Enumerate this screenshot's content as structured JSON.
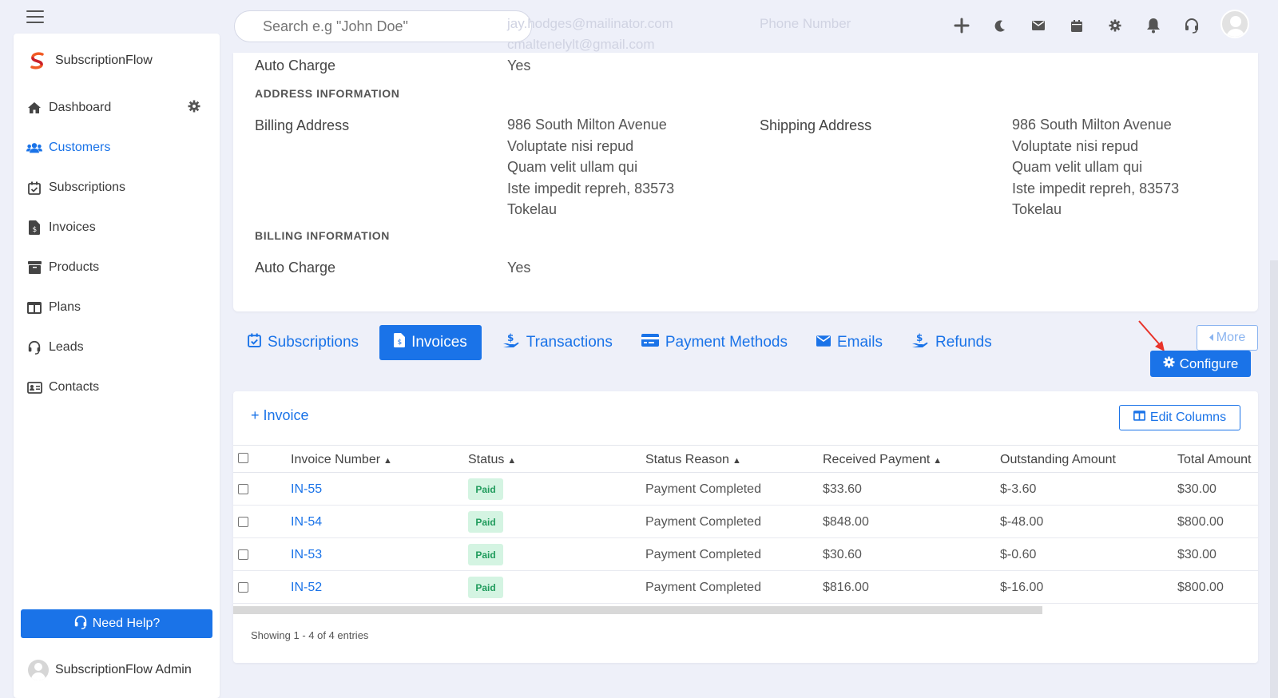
{
  "header": {
    "search_placeholder": "Search e.g \"John Doe\"",
    "ghost_email": "jay.hodges@mailinator.com",
    "ghost_phone": "Phone Number",
    "ghost_email2": "cmaltenelylt@gmail.com"
  },
  "sidebar": {
    "brand": "SubscriptionFlow",
    "items": [
      {
        "label": "Dashboard",
        "icon": "home-icon"
      },
      {
        "label": "Customers",
        "icon": "users-icon"
      },
      {
        "label": "Subscriptions",
        "icon": "calendar-check-icon"
      },
      {
        "label": "Invoices",
        "icon": "invoice-icon"
      },
      {
        "label": "Products",
        "icon": "archive-icon"
      },
      {
        "label": "Plans",
        "icon": "columns-icon"
      },
      {
        "label": "Leads",
        "icon": "headset-icon"
      },
      {
        "label": "Contacts",
        "icon": "id-card-icon"
      }
    ],
    "active": "Customers",
    "help_label": "Need Help?",
    "admin_name": "SubscriptionFlow Admin"
  },
  "info": {
    "auto_charge_label": "Auto Charge",
    "auto_charge_value": "Yes",
    "address_section": "ADDRESS INFORMATION",
    "billing_address_label": "Billing Address",
    "billing_address_lines": [
      "986 South Milton Avenue",
      "Voluptate nisi repud",
      "Quam velit ullam qui",
      "Iste impedit repreh, 83573",
      "Tokelau"
    ],
    "shipping_address_label": "Shipping Address",
    "shipping_address_lines": [
      "986 South Milton Avenue",
      "Voluptate nisi repud",
      "Quam velit ullam qui",
      "Iste impedit repreh, 83573",
      "Tokelau"
    ],
    "billing_section": "BILLING INFORMATION",
    "billing_auto_charge_label": "Auto Charge",
    "billing_auto_charge_value": "Yes"
  },
  "tabs": {
    "items": [
      "Subscriptions",
      "Invoices",
      "Transactions",
      "Payment Methods",
      "Emails",
      "Refunds"
    ],
    "active": "Invoices",
    "more_label": "More",
    "configure_label": "Configure"
  },
  "table": {
    "add_label": "+ Invoice",
    "edit_columns_label": "Edit Columns",
    "columns": [
      "Invoice Number",
      "Status",
      "Status Reason",
      "Received Payment",
      "Outstanding Amount",
      "Total Amount"
    ],
    "rows": [
      {
        "number": "IN-55",
        "status": "Paid",
        "reason": "Payment Completed",
        "received": "$33.60",
        "outstanding": "$-3.60",
        "total": "$30.00"
      },
      {
        "number": "IN-54",
        "status": "Paid",
        "reason": "Payment Completed",
        "received": "$848.00",
        "outstanding": "$-48.00",
        "total": "$800.00"
      },
      {
        "number": "IN-53",
        "status": "Paid",
        "reason": "Payment Completed",
        "received": "$30.60",
        "outstanding": "$-0.60",
        "total": "$30.00"
      },
      {
        "number": "IN-52",
        "status": "Paid",
        "reason": "Payment Completed",
        "received": "$816.00",
        "outstanding": "$-16.00",
        "total": "$800.00"
      }
    ],
    "showing": "Showing 1 - 4 of 4 entries"
  },
  "colors": {
    "accent": "#1a73e8",
    "paid_bg": "#d4f4e2",
    "paid_text": "#1f9b5c",
    "page_bg": "#eef0f9"
  }
}
